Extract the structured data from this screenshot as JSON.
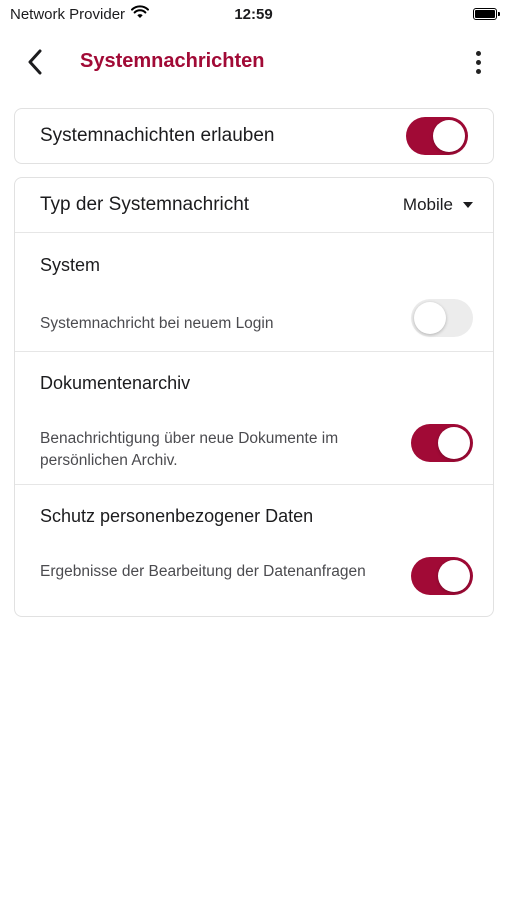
{
  "status_bar": {
    "carrier": "Network Provider",
    "time": "12:59",
    "wifi_icon": "wifi-icon",
    "battery_icon": "battery-icon"
  },
  "header": {
    "title": "Systemnachrichten",
    "back_icon": "chevron-left-icon",
    "more_icon": "more-vertical-icon"
  },
  "allow": {
    "label": "Systemnachichten erlauben",
    "enabled": true
  },
  "type_row": {
    "label": "Typ der Systemnachricht",
    "selected": "Mobile"
  },
  "sections": [
    {
      "title": "System",
      "description": "Systemnachricht bei neuem Login",
      "enabled": false
    },
    {
      "title": "Dokumentenarchiv",
      "description": "Benachrichtigung über neue Dokumente im persönlichen Archiv.",
      "enabled": true
    },
    {
      "title": "Schutz personenbezogener Daten",
      "description": "Ergebnisse der Bearbeitung der Datenanfragen",
      "enabled": true
    }
  ],
  "colors": {
    "accent": "#a10a36",
    "toggle_off": "#ececec",
    "border": "#e1e1e1"
  }
}
